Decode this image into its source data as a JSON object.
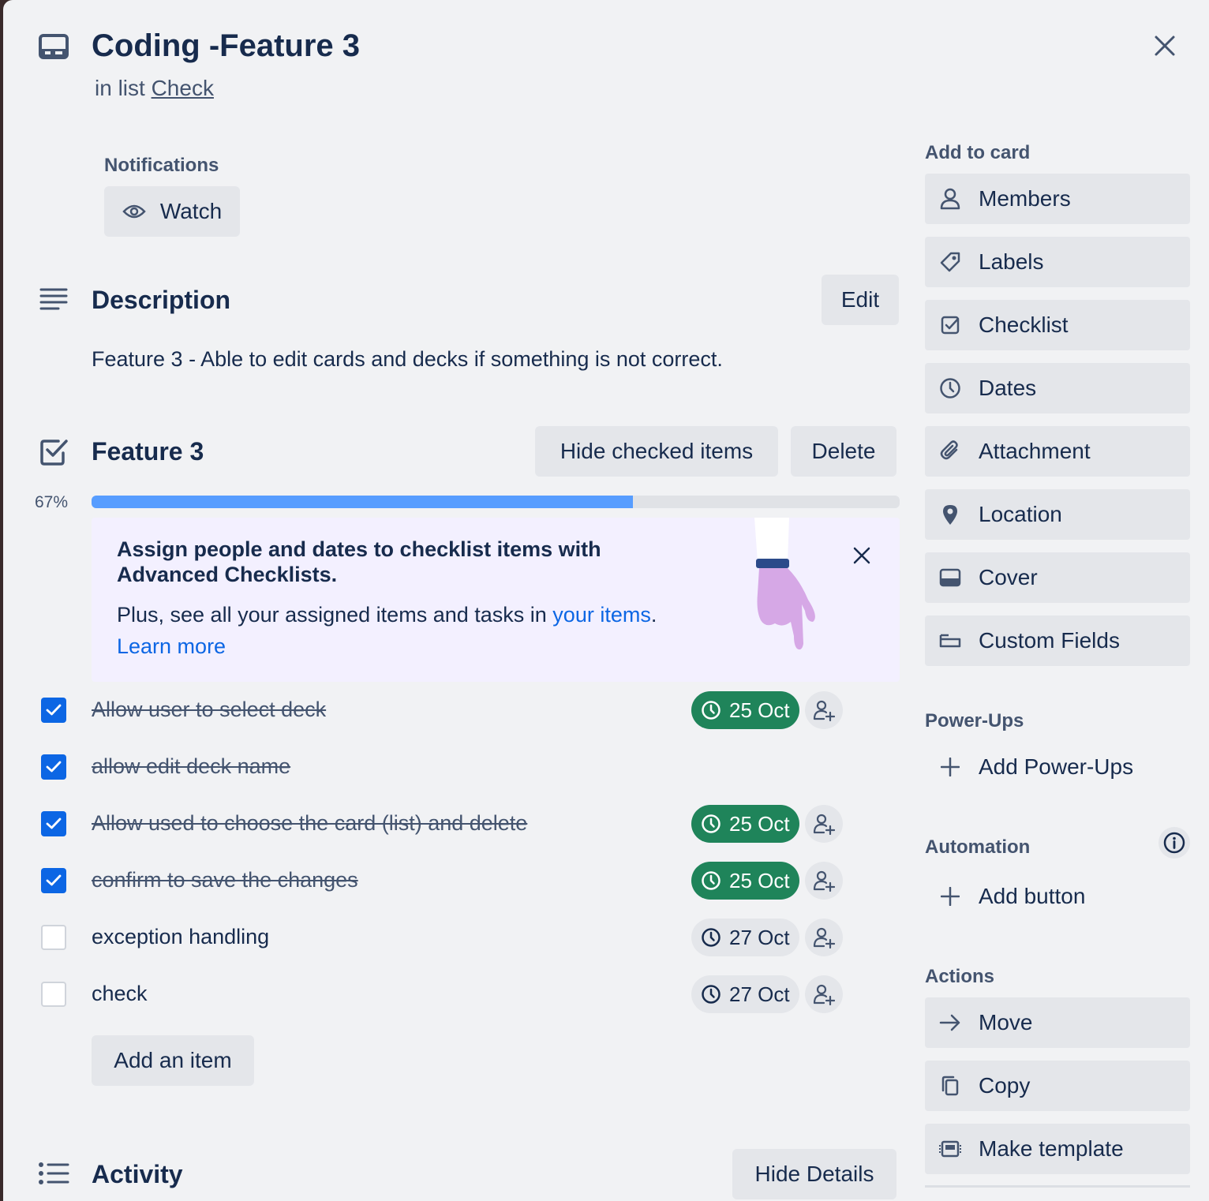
{
  "header": {
    "title": "Coding -Feature 3",
    "in_list_prefix": "in list",
    "list_name": "Check"
  },
  "notifications": {
    "label": "Notifications",
    "watch_label": "Watch"
  },
  "description": {
    "title": "Description",
    "edit_label": "Edit",
    "text": "Feature 3 - Able to edit cards and decks if something is not correct."
  },
  "checklist": {
    "title": "Feature 3",
    "hide_checked_label": "Hide checked items",
    "delete_label": "Delete",
    "progress_percent": "67%",
    "progress_value": 0.67,
    "add_item_label": "Add an item",
    "items": [
      {
        "text": "Allow user to select deck",
        "checked": true,
        "date": "25 Oct",
        "date_status": "complete"
      },
      {
        "text": "allow edit deck name",
        "checked": true,
        "date": "",
        "date_status": ""
      },
      {
        "text": "Allow used to choose the card (list) and delete",
        "checked": true,
        "date": "25 Oct",
        "date_status": "complete"
      },
      {
        "text": "confirm to save the changes",
        "checked": true,
        "date": "25 Oct",
        "date_status": "complete"
      },
      {
        "text": "exception handling",
        "checked": false,
        "date": "27 Oct",
        "date_status": "upcoming"
      },
      {
        "text": "check",
        "checked": false,
        "date": "27 Oct",
        "date_status": "upcoming"
      }
    ]
  },
  "promo": {
    "title": "Assign people and dates to checklist items with Advanced Checklists.",
    "body_prefix": "Plus, see all your assigned items and tasks in",
    "body_link": "your items",
    "body_suffix": ".",
    "learn_more": "Learn more"
  },
  "activity": {
    "title": "Activity",
    "hide_details_label": "Hide Details"
  },
  "sidebar": {
    "add_to_card_label": "Add to card",
    "add_to_card": [
      {
        "label": "Members",
        "icon": "person-icon"
      },
      {
        "label": "Labels",
        "icon": "tag-icon"
      },
      {
        "label": "Checklist",
        "icon": "checkbox-icon"
      },
      {
        "label": "Dates",
        "icon": "clock-icon"
      },
      {
        "label": "Attachment",
        "icon": "paperclip-icon"
      },
      {
        "label": "Location",
        "icon": "location-pin-icon"
      },
      {
        "label": "Cover",
        "icon": "card-cover-icon"
      },
      {
        "label": "Custom Fields",
        "icon": "custom-fields-icon"
      }
    ],
    "power_ups_label": "Power-Ups",
    "add_power_ups": "Add Power-Ups",
    "automation_label": "Automation",
    "add_button": "Add button",
    "actions_label": "Actions",
    "actions": [
      {
        "label": "Move",
        "icon": "arrow-right-icon"
      },
      {
        "label": "Copy",
        "icon": "copy-icon"
      },
      {
        "label": "Make template",
        "icon": "template-icon"
      }
    ]
  },
  "colors": {
    "accent_blue": "#0c66e4",
    "progress_blue": "#579dff",
    "complete_green": "#1f845a",
    "background": "#f1f2f4",
    "button_gray": "#e4e6ea",
    "promo_bg": "#f3f0ff"
  }
}
